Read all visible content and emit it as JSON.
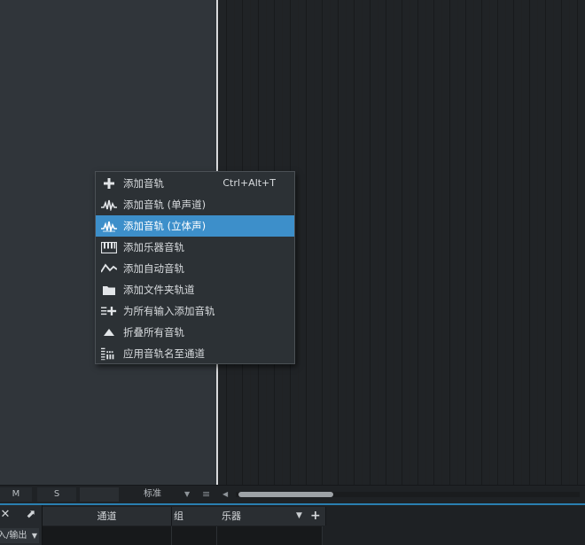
{
  "context_menu": {
    "items": [
      {
        "label": "添加音轨",
        "shortcut": "Ctrl+Alt+T",
        "icon": "plus-icon"
      },
      {
        "label": "添加音轨 (单声道)",
        "shortcut": "",
        "icon": "waveform-mono-icon"
      },
      {
        "label": "添加音轨 (立体声)",
        "shortcut": "",
        "icon": "waveform-stereo-icon",
        "highlighted": true
      },
      {
        "label": "添加乐器音轨",
        "shortcut": "",
        "icon": "keyboard-icon"
      },
      {
        "label": "添加自动音轨",
        "shortcut": "",
        "icon": "automation-curve-icon"
      },
      {
        "label": "添加文件夹轨道",
        "shortcut": "",
        "icon": "folder-icon"
      },
      {
        "label": "为所有输入添加音轨",
        "shortcut": "",
        "icon": "list-add-icon"
      },
      {
        "label": "折叠所有音轨",
        "shortcut": "",
        "icon": "collapse-triangle-icon"
      },
      {
        "label": "应用音轨名至通道",
        "shortcut": "",
        "icon": "apply-names-icon"
      }
    ]
  },
  "bottom_bar": {
    "mute_label": "M",
    "solo_label": "S",
    "view_mode": "标准"
  },
  "console": {
    "io_label": "入/输出",
    "columns": {
      "channel": "通道",
      "group": "组",
      "instrument": "乐器"
    }
  },
  "colors": {
    "highlight": "#3d8fca",
    "accent_line": "#2a7fb0",
    "menu_bg": "#2c3135"
  }
}
